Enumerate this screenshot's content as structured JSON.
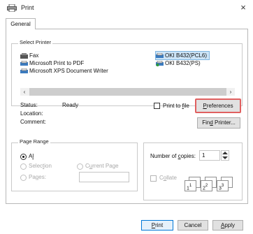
{
  "window": {
    "title": "Print",
    "close_glyph": "×"
  },
  "tabs": [
    {
      "label": "General"
    }
  ],
  "select_printer": {
    "title": "Select Printer",
    "printers_left": [
      "Fax",
      "Microsoft Print to PDF",
      "Microsoft XPS Document Writer"
    ],
    "printers_right": [
      "OKI B432(PCL6)",
      "OKI B432(PS)"
    ],
    "selected_printer": "OKI B432(PCL6)"
  },
  "status": {
    "status_label": "Status:",
    "status_value": "Ready",
    "location_label": "Location:",
    "location_value": "",
    "comment_label": "Comment:",
    "comment_value": ""
  },
  "print_to_file": {
    "label_pre": "Print to ",
    "label_u": "f",
    "label_post": "ile",
    "checked": false
  },
  "buttons": {
    "preferences_u": "P",
    "preferences_rest": "references",
    "find_pre": "Fin",
    "find_u": "d",
    "find_post": " Printer...",
    "print_u": "P",
    "print_rest": "rint",
    "cancel": "Cancel",
    "apply_u": "A",
    "apply_rest": "pply"
  },
  "page_range": {
    "title": "Page Range",
    "all_u": "l",
    "all_pre": "A",
    "all_post": "",
    "selection_pre": "Selec",
    "selection_u": "t",
    "selection_post": "ion",
    "current_pre": "C",
    "current_u": "u",
    "current_post": "rrent Page",
    "pages_pre": "Pa",
    "pages_u": "g",
    "pages_post": "es:",
    "pages_value": "",
    "selected": "All"
  },
  "copies": {
    "label_pre": "Number of ",
    "label_u": "c",
    "label_post": "opies:",
    "value": "1",
    "collate_pre": "C",
    "collate_u": "o",
    "collate_post": "llate",
    "collate_checked": false,
    "collate_pages": [
      {
        "big": "1",
        "small": "1"
      },
      {
        "big": "2",
        "small": "2"
      },
      {
        "big": "3",
        "small": "3"
      }
    ]
  },
  "colors": {
    "highlight": "#e06060",
    "selected_bg": "#cce4f7"
  }
}
